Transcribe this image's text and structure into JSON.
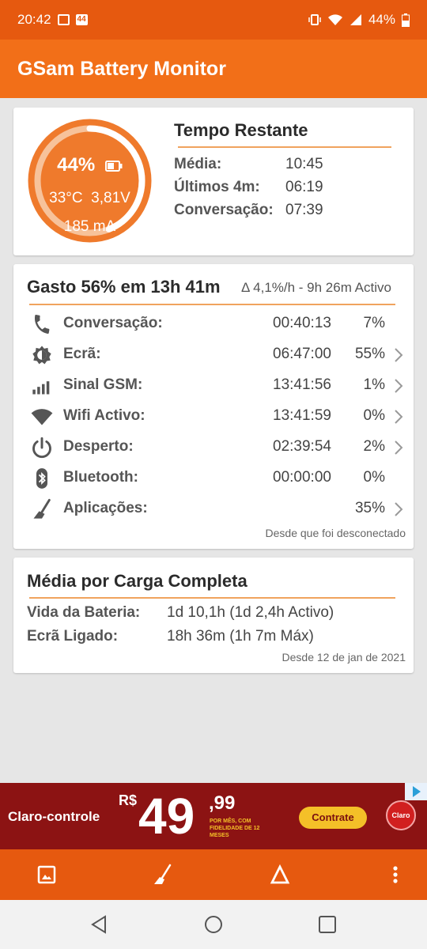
{
  "status_bar": {
    "time": "20:42",
    "battery": "44%",
    "icons": [
      "image-icon",
      "app-badge-icon",
      "vibrate-icon",
      "wifi-icon",
      "signal-icon",
      "battery-icon"
    ]
  },
  "app": {
    "title": "GSam Battery Monitor",
    "accent": "#f26f18",
    "status_color": "#e6590f"
  },
  "gauge": {
    "percent": "44%",
    "temp": "33°C",
    "voltage": "3,81V",
    "current": "185 mA",
    "fill_fraction": 0.44
  },
  "time_remaining": {
    "title": "Tempo Restante",
    "rows": [
      {
        "label": "Média:",
        "value": "10:45"
      },
      {
        "label": "Últimos 4m:",
        "value": "06:19"
      },
      {
        "label": "Conversação:",
        "value": "07:39"
      }
    ]
  },
  "usage": {
    "title": "Gasto 56% em 13h 41m",
    "subtitle": "Δ 4,1%/h - 9h 26m Activo",
    "rows": [
      {
        "icon": "phone-icon",
        "label": "Conversação:",
        "time": "00:40:13",
        "pct": "7%",
        "chevron": false
      },
      {
        "icon": "screen-brightness-icon",
        "label": "Ecrã:",
        "time": "06:47:00",
        "pct": "55%",
        "chevron": true
      },
      {
        "icon": "cell-signal-icon",
        "label": "Sinal GSM:",
        "time": "13:41:56",
        "pct": "1%",
        "chevron": true
      },
      {
        "icon": "wifi-icon",
        "label": "Wifi Activo:",
        "time": "13:41:59",
        "pct": "0%",
        "chevron": true
      },
      {
        "icon": "power-icon",
        "label": "Desperto:",
        "time": "02:39:54",
        "pct": "2%",
        "chevron": true
      },
      {
        "icon": "bluetooth-icon",
        "label": "Bluetooth:",
        "time": "00:00:00",
        "pct": "0%",
        "chevron": false
      },
      {
        "icon": "broom-icon",
        "label": "Aplicações:",
        "time": "",
        "pct": "35%",
        "chevron": true
      }
    ],
    "footer": "Desde que foi desconectado"
  },
  "full_charge": {
    "title": "Média por Carga Completa",
    "rows": [
      {
        "label": "Vida da Bateria:",
        "value": "1d 10,1h (1d 2,4h Activo)"
      },
      {
        "label": "Ecrã Ligado:",
        "value": "18h 36m (1h 7m Máx)"
      }
    ],
    "footer": "Desde 12 de jan de 2021"
  },
  "ad": {
    "brand": "Claro-controle",
    "currency": "R$",
    "price": "49",
    "cents": ",99",
    "fine_print": "POR MÊS, COM FIDELIDADE DE 12 MESES",
    "cta": "Contrate",
    "logo": "Claro"
  },
  "bottom_bar": {
    "icons": [
      "image-icon",
      "broom-icon",
      "delta-icon",
      "more-vert-icon"
    ]
  },
  "nav_bar": {
    "icons": [
      "back-icon",
      "home-icon",
      "recents-icon"
    ]
  }
}
